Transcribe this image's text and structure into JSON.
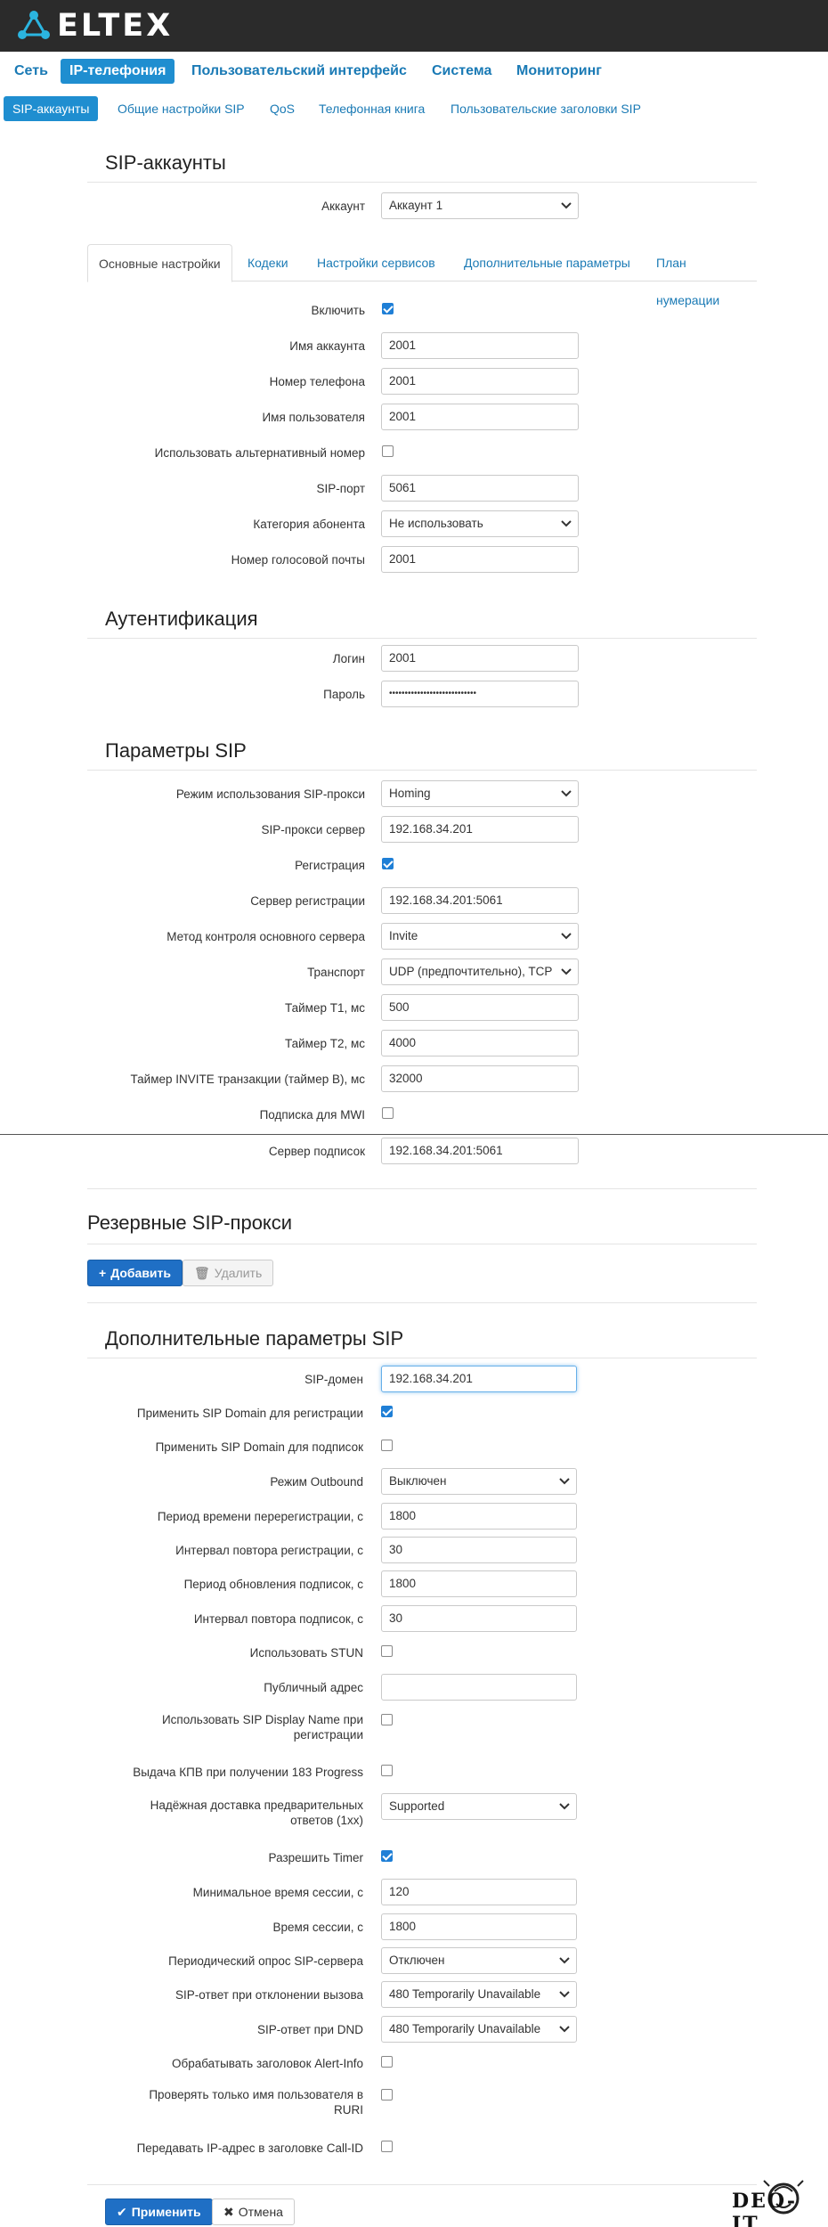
{
  "brand": {
    "logo_text": "ELTEX"
  },
  "main_nav": [
    "Сеть",
    "IP-телефония",
    "Пользовательский интерфейс",
    "Система",
    "Мониторинг"
  ],
  "sub_nav": [
    "SIP-аккаунты",
    "Общие настройки SIP",
    "QoS",
    "Телефонная книга",
    "Пользовательские заголовки SIP"
  ],
  "sip_accounts": {
    "title": "SIP-аккаунты",
    "account_label": "Аккаунт",
    "account_value": "Аккаунт 1"
  },
  "tabs": [
    "Основные настройки",
    "Кодеки",
    "Настройки сервисов",
    "Дополнительные параметры",
    "План нумерации"
  ],
  "basic": {
    "enable_label": "Включить",
    "enable_checked": true,
    "account_name_label": "Имя аккаунта",
    "account_name_value": "2001",
    "phone_label": "Номер телефона",
    "phone_value": "2001",
    "username_label": "Имя пользователя",
    "username_value": "2001",
    "alt_number_label": "Использовать альтернативный номер",
    "alt_number_checked": false,
    "sip_port_label": "SIP-порт",
    "sip_port_value": "5061",
    "category_label": "Категория абонента",
    "category_value": "Не использовать",
    "voicemail_label": "Номер голосовой почты",
    "voicemail_value": "2001"
  },
  "auth": {
    "title": "Аутентификация",
    "login_label": "Логин",
    "login_value": "2001",
    "password_label": "Пароль",
    "password_value": "••••••••••••••••••••••••••••"
  },
  "sip_params": {
    "title": "Параметры SIP",
    "proxy_mode_label": "Режим использования SIP-прокси",
    "proxy_mode_value": "Homing",
    "proxy_server_label": "SIP-прокси сервер",
    "proxy_server_value": "192.168.34.201",
    "registration_label": "Регистрация",
    "registration_checked": true,
    "reg_server_label": "Сервер регистрации",
    "reg_server_value": "192.168.34.201:5061",
    "control_method_label": "Метод контроля основного сервера",
    "control_method_value": "Invite",
    "transport_label": "Транспорт",
    "transport_value": "UDP (предпочтительно), TCP",
    "t1_label": "Таймер T1, мс",
    "t1_value": "500",
    "t2_label": "Таймер T2, мс",
    "t2_value": "4000",
    "invite_label": "Таймер INVITE транзакции (таймер B), мс",
    "invite_value": "32000",
    "mwi_label": "Подписка для MWI",
    "mwi_checked": false,
    "sub_server_label": "Сервер подписок",
    "sub_server_value": "192.168.34.201:5061"
  },
  "backup": {
    "title": "Резервные SIP-прокси",
    "add_label": "Добавить",
    "delete_label": "Удалить"
  },
  "extra": {
    "title": "Дополнительные параметры SIP",
    "domain_label": "SIP-домен",
    "domain_value": "192.168.34.201",
    "domain_reg_label": "Применить SIP Domain для регистрации",
    "domain_reg_checked": true,
    "domain_sub_label": "Применить SIP Domain для подписок",
    "domain_sub_checked": false,
    "outbound_label": "Режим Outbound",
    "outbound_value": "Выключен",
    "rereg_label": "Период времени перерегистрации, с",
    "rereg_value": "1800",
    "reg_retry_label": "Интервал повтора регистрации, с",
    "reg_retry_value": "30",
    "sub_refresh_label": "Период обновления подписок, с",
    "sub_refresh_value": "1800",
    "sub_retry_label": "Интервал повтора подписок, с",
    "sub_retry_value": "30",
    "stun_label": "Использовать STUN",
    "stun_checked": false,
    "public_label": "Публичный адрес",
    "public_value": "",
    "display_name_label_1": "Использовать SIP Display Name при",
    "display_name_label_2": "регистрации",
    "display_name_checked": false,
    "kpv_label": "Выдача КПВ при получении 183 Progress",
    "kpv_checked": false,
    "reliable_label_1": "Надёжная доставка предварительных",
    "reliable_label_2": "ответов (1xx)",
    "reliable_value": "Supported",
    "timer_label": "Разрешить Timer",
    "timer_checked": true,
    "min_session_label": "Минимальное время сессии, с",
    "min_session_value": "120",
    "session_label": "Время сессии, с",
    "session_value": "1800",
    "options_label": "Периодический опрос SIP-сервера",
    "options_value": "Отключен",
    "reject_label": "SIP-ответ при отклонении вызова",
    "reject_value": "480 Temporarily Unavailable",
    "dnd_label": "SIP-ответ при DND",
    "dnd_value": "480 Temporarily Unavailable",
    "alert_label": "Обрабатывать заголовок Alert-Info",
    "alert_checked": false,
    "ruri_label_1": "Проверять только имя пользователя в",
    "ruri_label_2": "RURI",
    "ruri_checked": false,
    "callid_label": "Передавать IP-адрес в заголовке Call-ID",
    "callid_checked": false
  },
  "footer": {
    "apply_label": "Применить",
    "cancel_label": "Отмена"
  },
  "watermark": "DEO-IT"
}
